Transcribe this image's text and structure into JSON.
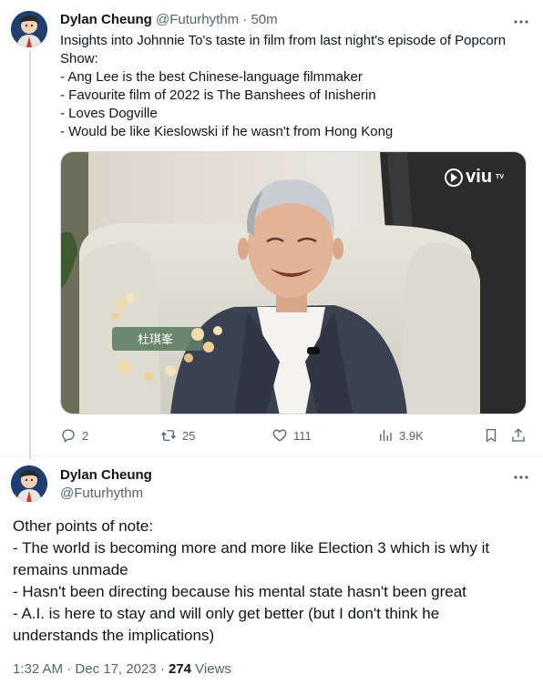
{
  "tweet1": {
    "author_name": "Dylan Cheung",
    "author_handle": "@Futurhythm",
    "separator": " · ",
    "time": "50m",
    "lines": [
      "Insights into Johnnie To's taste in film from last night's episode of Popcorn",
      "Show:",
      "- Ang Lee is the best Chinese-language filmmaker",
      "- Favourite film of 2022 is The Banshees of Inisherin",
      "- Loves Dogville",
      "- Would be like Kieslowski if he wasn't from Hong Kong"
    ],
    "media": {
      "watermark": "viu",
      "watermark_suffix": "TV",
      "caption_chinese": "杜琪峯"
    },
    "actions": {
      "replies": "2",
      "retweets": "25",
      "likes": "111",
      "views": "3.9K"
    }
  },
  "tweet2": {
    "author_name": "Dylan Cheung",
    "author_handle": "@Futurhythm",
    "lines": [
      "Other points of note:",
      "- The world is becoming more and more like Election 3 which is why it",
      "remains unmade",
      "- Hasn't been directing because his mental state hasn't been great",
      "- A.I. is here to stay and will only get better (but I don't think he",
      "understands the implications)"
    ],
    "time": "1:32 AM",
    "date": "Dec 17, 2023",
    "separator": " · ",
    "views_count": "274",
    "views_label": "Views"
  },
  "colors": {
    "text_primary": "#0f1419",
    "text_secondary": "#536471",
    "border": "#cfd9de"
  },
  "icons": {
    "reply": "reply-icon",
    "retweet": "retweet-icon",
    "like": "heart-icon",
    "views": "analytics-icon",
    "bookmark": "bookmark-icon",
    "share": "share-icon",
    "more": "more-icon"
  }
}
